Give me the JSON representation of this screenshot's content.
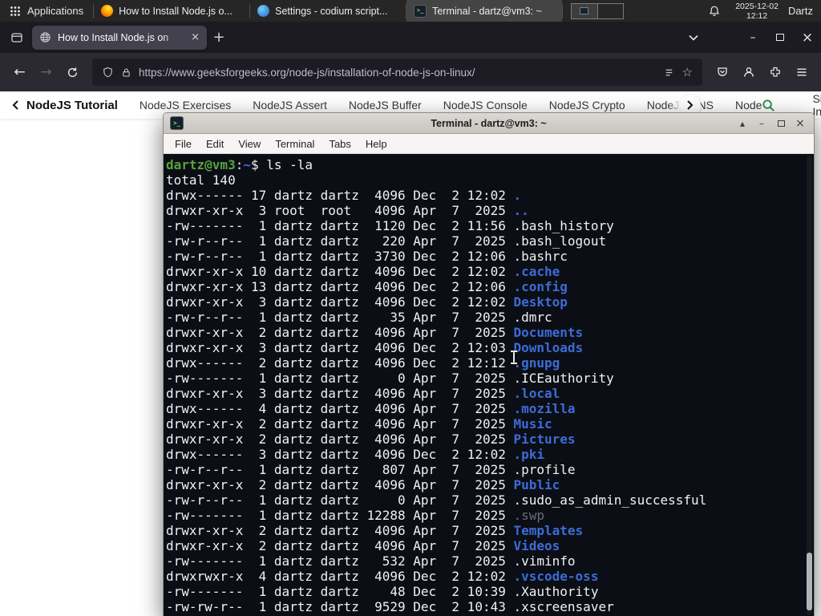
{
  "panel": {
    "applications_label": "Applications",
    "tasks": [
      {
        "title": "How to Install Node.js o..."
      },
      {
        "title": "Settings - codium script..."
      },
      {
        "title": "Terminal - dartz@vm3: ~"
      }
    ],
    "clock": {
      "date": "2025-12-02",
      "time": "12:12"
    },
    "user_label": "Dartz"
  },
  "browser": {
    "tab_title": "How to Install Node.js on",
    "url": "https://www.geeksforgeeks.org/node-js/installation-of-node-js-on-linux/",
    "gfg": {
      "title": "NodeJS Tutorial",
      "links": [
        "NodeJS Exercises",
        "NodeJS Assert",
        "NodeJS Buffer",
        "NodeJS Console",
        "NodeJS Crypto",
        "NodeJS DNS",
        "Node"
      ],
      "sign_in": "Sign In"
    }
  },
  "terminal": {
    "window_title": "Terminal - dartz@vm3: ~",
    "menu": [
      "File",
      "Edit",
      "View",
      "Terminal",
      "Tabs",
      "Help"
    ],
    "prompt": {
      "user_host": "dartz@vm3",
      "colon": ":",
      "path": "~",
      "symbol": "$ ",
      "command": "ls -la"
    },
    "total_line": "total 140",
    "listing": [
      {
        "perms": "drwx------",
        "links": 17,
        "owner": "dartz",
        "group": "dartz",
        "size": 4096,
        "month": "Dec",
        "day": 2,
        "date": "12:02",
        "name": ".",
        "color": "dir"
      },
      {
        "perms": "drwxr-xr-x",
        "links": 3,
        "owner": "root",
        "group": "root",
        "size": 4096,
        "month": "Apr",
        "day": 7,
        "date": "2025",
        "name": "..",
        "color": "dir"
      },
      {
        "perms": "-rw-------",
        "links": 1,
        "owner": "dartz",
        "group": "dartz",
        "size": 1120,
        "month": "Dec",
        "day": 2,
        "date": "11:56",
        "name": ".bash_history",
        "color": "file"
      },
      {
        "perms": "-rw-r--r--",
        "links": 1,
        "owner": "dartz",
        "group": "dartz",
        "size": 220,
        "month": "Apr",
        "day": 7,
        "date": "2025",
        "name": ".bash_logout",
        "color": "file"
      },
      {
        "perms": "-rw-r--r--",
        "links": 1,
        "owner": "dartz",
        "group": "dartz",
        "size": 3730,
        "month": "Dec",
        "day": 2,
        "date": "12:06",
        "name": ".bashrc",
        "color": "file"
      },
      {
        "perms": "drwxr-xr-x",
        "links": 10,
        "owner": "dartz",
        "group": "dartz",
        "size": 4096,
        "month": "Dec",
        "day": 2,
        "date": "12:02",
        "name": ".cache",
        "color": "dir"
      },
      {
        "perms": "drwxr-xr-x",
        "links": 13,
        "owner": "dartz",
        "group": "dartz",
        "size": 4096,
        "month": "Dec",
        "day": 2,
        "date": "12:06",
        "name": ".config",
        "color": "dir"
      },
      {
        "perms": "drwxr-xr-x",
        "links": 3,
        "owner": "dartz",
        "group": "dartz",
        "size": 4096,
        "month": "Dec",
        "day": 2,
        "date": "12:02",
        "name": "Desktop",
        "color": "dir"
      },
      {
        "perms": "-rw-r--r--",
        "links": 1,
        "owner": "dartz",
        "group": "dartz",
        "size": 35,
        "month": "Apr",
        "day": 7,
        "date": "2025",
        "name": ".dmrc",
        "color": "file"
      },
      {
        "perms": "drwxr-xr-x",
        "links": 2,
        "owner": "dartz",
        "group": "dartz",
        "size": 4096,
        "month": "Apr",
        "day": 7,
        "date": "2025",
        "name": "Documents",
        "color": "dir"
      },
      {
        "perms": "drwxr-xr-x",
        "links": 3,
        "owner": "dartz",
        "group": "dartz",
        "size": 4096,
        "month": "Dec",
        "day": 2,
        "date": "12:03",
        "name": "Downloads",
        "color": "dir"
      },
      {
        "perms": "drwx------",
        "links": 2,
        "owner": "dartz",
        "group": "dartz",
        "size": 4096,
        "month": "Dec",
        "day": 2,
        "date": "12:12",
        "name": ".gnupg",
        "color": "dir"
      },
      {
        "perms": "-rw-------",
        "links": 1,
        "owner": "dartz",
        "group": "dartz",
        "size": 0,
        "month": "Apr",
        "day": 7,
        "date": "2025",
        "name": ".ICEauthority",
        "color": "file"
      },
      {
        "perms": "drwxr-xr-x",
        "links": 3,
        "owner": "dartz",
        "group": "dartz",
        "size": 4096,
        "month": "Apr",
        "day": 7,
        "date": "2025",
        "name": ".local",
        "color": "dir"
      },
      {
        "perms": "drwx------",
        "links": 4,
        "owner": "dartz",
        "group": "dartz",
        "size": 4096,
        "month": "Apr",
        "day": 7,
        "date": "2025",
        "name": ".mozilla",
        "color": "dir"
      },
      {
        "perms": "drwxr-xr-x",
        "links": 2,
        "owner": "dartz",
        "group": "dartz",
        "size": 4096,
        "month": "Apr",
        "day": 7,
        "date": "2025",
        "name": "Music",
        "color": "dir"
      },
      {
        "perms": "drwxr-xr-x",
        "links": 2,
        "owner": "dartz",
        "group": "dartz",
        "size": 4096,
        "month": "Apr",
        "day": 7,
        "date": "2025",
        "name": "Pictures",
        "color": "dir"
      },
      {
        "perms": "drwx------",
        "links": 3,
        "owner": "dartz",
        "group": "dartz",
        "size": 4096,
        "month": "Dec",
        "day": 2,
        "date": "12:02",
        "name": ".pki",
        "color": "dir"
      },
      {
        "perms": "-rw-r--r--",
        "links": 1,
        "owner": "dartz",
        "group": "dartz",
        "size": 807,
        "month": "Apr",
        "day": 7,
        "date": "2025",
        "name": ".profile",
        "color": "file"
      },
      {
        "perms": "drwxr-xr-x",
        "links": 2,
        "owner": "dartz",
        "group": "dartz",
        "size": 4096,
        "month": "Apr",
        "day": 7,
        "date": "2025",
        "name": "Public",
        "color": "dir"
      },
      {
        "perms": "-rw-r--r--",
        "links": 1,
        "owner": "dartz",
        "group": "dartz",
        "size": 0,
        "month": "Apr",
        "day": 7,
        "date": "2025",
        "name": ".sudo_as_admin_successful",
        "color": "file"
      },
      {
        "perms": "-rw-------",
        "links": 1,
        "owner": "dartz",
        "group": "dartz",
        "size": 12288,
        "month": "Apr",
        "day": 7,
        "date": "2025",
        "name": ".swp",
        "color": "dim"
      },
      {
        "perms": "drwxr-xr-x",
        "links": 2,
        "owner": "dartz",
        "group": "dartz",
        "size": 4096,
        "month": "Apr",
        "day": 7,
        "date": "2025",
        "name": "Templates",
        "color": "dir"
      },
      {
        "perms": "drwxr-xr-x",
        "links": 2,
        "owner": "dartz",
        "group": "dartz",
        "size": 4096,
        "month": "Apr",
        "day": 7,
        "date": "2025",
        "name": "Videos",
        "color": "dir"
      },
      {
        "perms": "-rw-------",
        "links": 1,
        "owner": "dartz",
        "group": "dartz",
        "size": 532,
        "month": "Apr",
        "day": 7,
        "date": "2025",
        "name": ".viminfo",
        "color": "file"
      },
      {
        "perms": "drwxrwxr-x",
        "links": 4,
        "owner": "dartz",
        "group": "dartz",
        "size": 4096,
        "month": "Dec",
        "day": 2,
        "date": "12:02",
        "name": ".vscode-oss",
        "color": "dir"
      },
      {
        "perms": "-rw-------",
        "links": 1,
        "owner": "dartz",
        "group": "dartz",
        "size": 48,
        "month": "Dec",
        "day": 2,
        "date": "10:39",
        "name": ".Xauthority",
        "color": "file"
      },
      {
        "perms": "-rw-rw-r--",
        "links": 1,
        "owner": "dartz",
        "group": "dartz",
        "size": 9529,
        "month": "Dec",
        "day": 2,
        "date": "10:43",
        "name": ".xscreensaver",
        "color": "file"
      }
    ],
    "colors": {
      "background": "#0c0e16",
      "foreground": "#f1f1f1",
      "directory": "#3c6cd6",
      "prompt_green": "#57a33a",
      "dim": "#6b6b75"
    }
  },
  "icons": {
    "new_tab": "+",
    "tab_close": "×",
    "window_minimize": "–",
    "window_close": "×",
    "back_arrow": "←",
    "forward_arrow": "→",
    "bookmark_star": "☆",
    "shade": "▴"
  }
}
